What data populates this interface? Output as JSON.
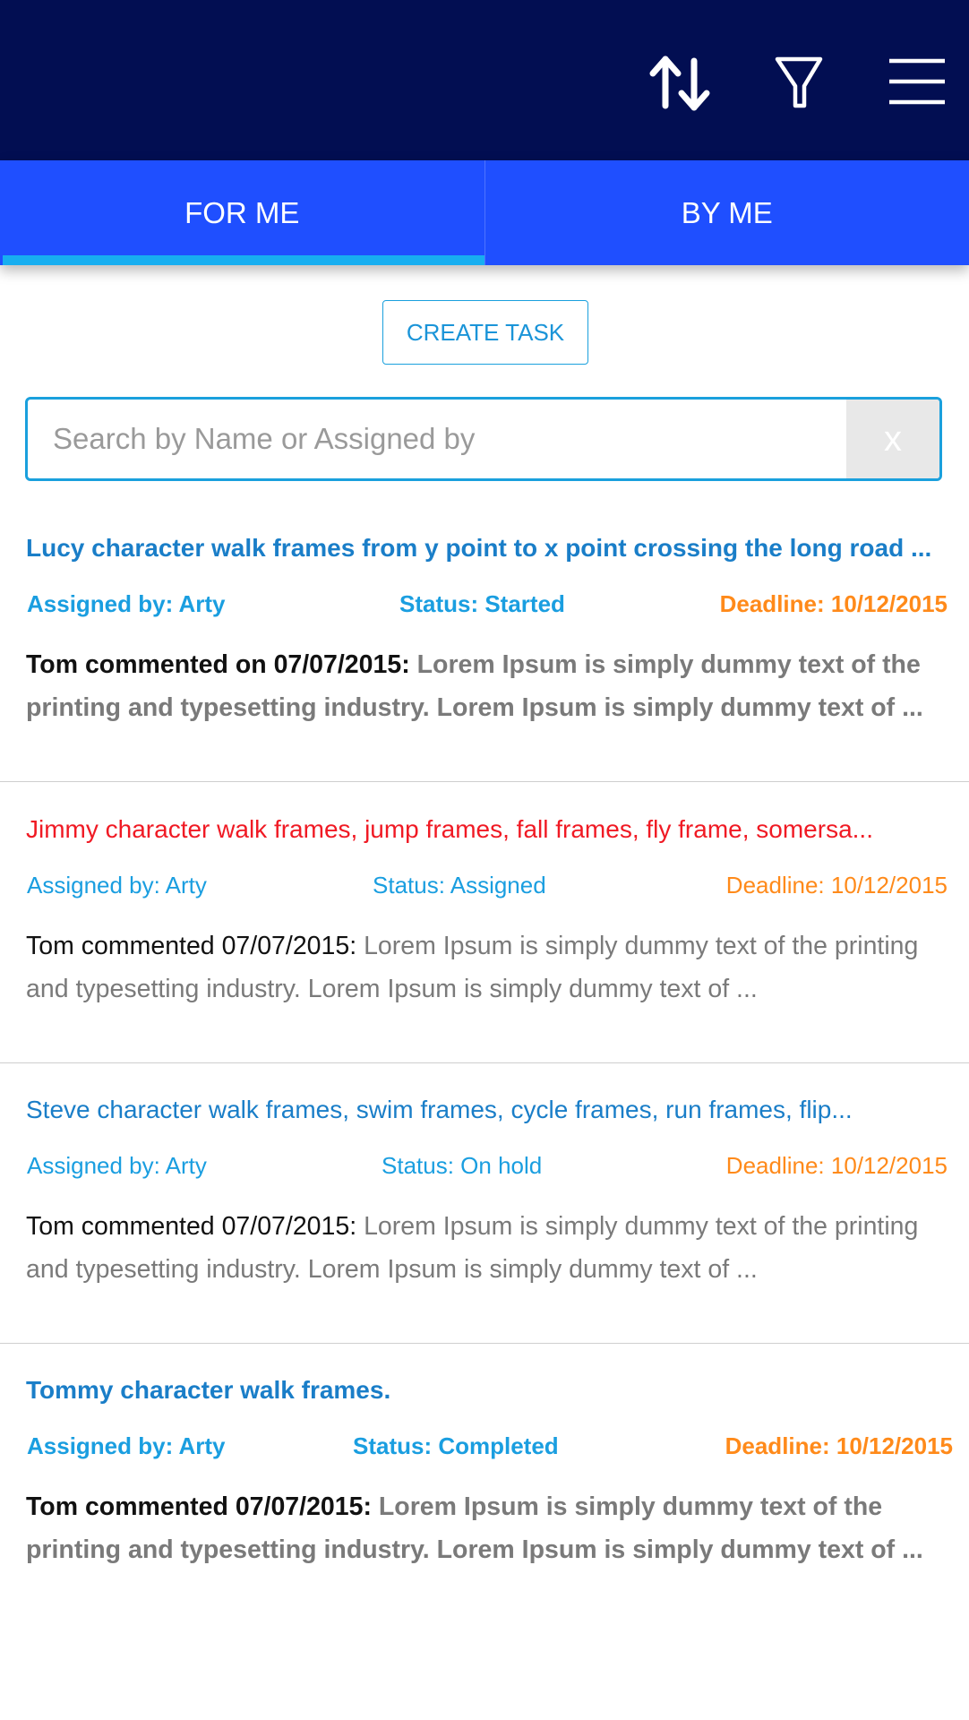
{
  "colors": {
    "header_bg": "#020e52",
    "tab_bg": "#1f4fff",
    "tab_indicator": "#17aef0",
    "accent_blue": "#1a9ee0",
    "title_blue": "#1a7ec8",
    "title_red": "#f01a24",
    "deadline_orange": "#ff8a1a"
  },
  "header": {
    "icons": [
      "sort-icon",
      "filter-icon",
      "menu-icon"
    ]
  },
  "tabs": [
    {
      "label": "FOR ME",
      "active": true
    },
    {
      "label": "BY ME",
      "active": false
    }
  ],
  "create_task": {
    "label": "CREATE TASK"
  },
  "search": {
    "placeholder": "Search by Name or Assigned by",
    "value": "",
    "clear_label": "x"
  },
  "tasks": [
    {
      "title": "Lucy character walk frames from y point to x point crossing the long road ...",
      "title_color": "#1a7ec8",
      "assigned": "Assigned by: Arty",
      "status": "Status: Started",
      "deadline": "Deadline: 10/12/2015",
      "comment_by": "Tom commented on 07/07/2015: ",
      "comment_text": "Lorem Ipsum is simply dummy text of the printing and typesetting industry. Lorem Ipsum is simply dummy text of ...",
      "bold": true
    },
    {
      "title": "Jimmy character walk frames, jump frames, fall frames, fly frame, somersa...",
      "title_color": "#f01a24",
      "assigned": "Assigned by: Arty",
      "status": "Status: Assigned",
      "deadline": "Deadline: 10/12/2015",
      "comment_by": "Tom commented 07/07/2015: ",
      "comment_text": "Lorem Ipsum is simply dummy text of the printing and typesetting industry. Lorem Ipsum is simply dummy text of ...",
      "bold": false
    },
    {
      "title": "Steve character walk frames, swim frames, cycle frames, run frames, flip...",
      "title_color": "#1a7ec8",
      "assigned": "Assigned by: Arty",
      "status": "Status: On hold",
      "deadline": "Deadline: 10/12/2015",
      "comment_by": "Tom commented 07/07/2015: ",
      "comment_text": "Lorem Ipsum is simply dummy text of the printing and typesetting industry. Lorem Ipsum is simply dummy text of ...",
      "bold": false
    },
    {
      "title": "Tommy character walk frames.",
      "title_color": "#1a7ec8",
      "assigned": "Assigned by: Arty",
      "status": "Status: Completed",
      "deadline": "Deadline: 10/12/2015",
      "comment_by": "Tom commented 07/07/2015: ",
      "comment_text": "Lorem Ipsum is simply dummy text of the printing and typesetting industry. Lorem Ipsum is simply dummy text of ...",
      "bold": true
    }
  ]
}
